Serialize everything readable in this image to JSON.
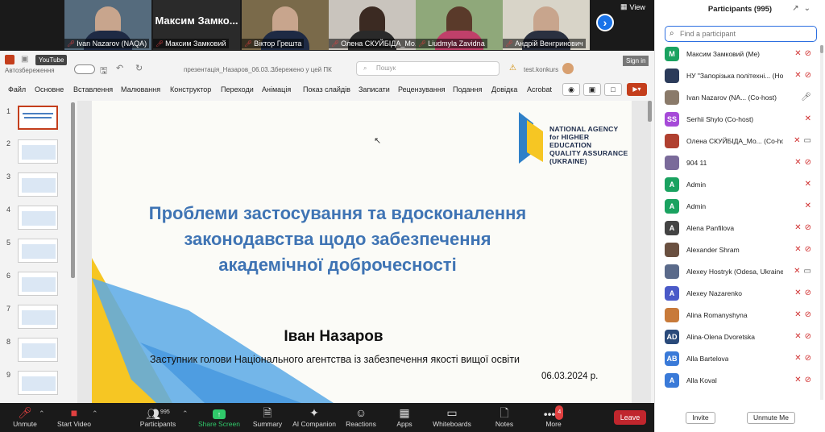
{
  "gallery": {
    "tiles": [
      {
        "name": "Ivan Nazarov (NAQA)"
      },
      {
        "name": "Максим Замковий",
        "big": "Максим Замко..."
      },
      {
        "name": "Віктор Грешта"
      },
      {
        "name": "Олена СКУЙБІДА_Мо..."
      },
      {
        "name": "Liudmyla Zavidna"
      },
      {
        "name": "Андрій Венгринович"
      }
    ],
    "view_label": "View"
  },
  "ppt": {
    "youtube": "YouTube",
    "autosave": "Автозбереження",
    "filename": "презентація_Назаров_06.03....",
    "saved": "Збережено у цей ПК",
    "search_placeholder": "Пошук",
    "account": "test.konkurs",
    "signin": "Sign in",
    "ribbon_tabs": [
      "Файл",
      "Основне",
      "Вставлення",
      "Малювання",
      "Конструктор",
      "Переходи",
      "Анімація",
      "Показ слайдів",
      "Записати",
      "Рецензування",
      "Подання",
      "Довідка",
      "Acrobat"
    ],
    "thumb_numbers": [
      "1",
      "2",
      "3",
      "4",
      "5",
      "6",
      "7",
      "8",
      "9"
    ],
    "slide": {
      "agency": [
        "NATIONAL AGENCY",
        "for HIGHER EDUCATION",
        "QUALITY ASSURANCE",
        "(UKRAINE)"
      ],
      "title": [
        "Проблеми застосування та вдосконалення",
        "законодавства щодо забезпечення",
        "академічної доброчесності"
      ],
      "author": "Іван Назаров",
      "position": "Заступник голови Національного агентства із забезпечення якості вищої освіти",
      "date": "06.03.2024 р."
    }
  },
  "toolbar": {
    "unmute": "Unmute",
    "start_video": "Start Video",
    "participants": "Participants",
    "participants_count": "995",
    "share": "Share Screen",
    "summary": "Summary",
    "ai": "AI Companion",
    "reactions": "Reactions",
    "apps": "Apps",
    "whiteboards": "Whiteboards",
    "notes": "Notes",
    "more": "More",
    "more_badge": "4",
    "leave": "Leave"
  },
  "panel": {
    "title": "Participants (995)",
    "find_placeholder": "Find a participant",
    "invite": "Invite",
    "mute_me": "Unmute Me",
    "participants": [
      {
        "initial": "M",
        "color": "#1aa260",
        "name": "Максим Замковий (Me)",
        "video": "off"
      },
      {
        "initial": "",
        "color": "#2b3b5a",
        "name": "НУ \"Запорізька політехні... (Host)",
        "video": "off"
      },
      {
        "initial": "",
        "color": "#8a7a6a",
        "name": "Ivan Nazarov (NA... (Co-host)",
        "video": "on"
      },
      {
        "initial": "SS",
        "color": "#a64ad8",
        "name": "Serhii Shylo (Co-host)",
        "video": "none"
      },
      {
        "initial": "",
        "color": "#b04030",
        "name": "Олена СКУЙБІДА_Мо... (Co-host)",
        "video": "cam"
      },
      {
        "initial": "",
        "color": "#7a6a9a",
        "name": "904 11",
        "video": "off"
      },
      {
        "initial": "A",
        "color": "#1aa260",
        "name": "Admin",
        "video": "none"
      },
      {
        "initial": "A",
        "color": "#1aa260",
        "name": "Admin",
        "video": "none"
      },
      {
        "initial": "A",
        "color": "#444444",
        "name": "Alena Panfilova",
        "video": "off"
      },
      {
        "initial": "",
        "color": "#6a5040",
        "name": "Alexander Shram",
        "video": "off"
      },
      {
        "initial": "",
        "color": "#5a6a8a",
        "name": "Alexey Hostryk (Odesa, Ukraine)",
        "video": "cam"
      },
      {
        "initial": "A",
        "color": "#4a5ac8",
        "name": "Alexey Nazarenko",
        "video": "off"
      },
      {
        "initial": "",
        "color": "#c87a3a",
        "name": "Alina Romanyshyna",
        "video": "off"
      },
      {
        "initial": "AD",
        "color": "#2a4a7a",
        "name": "Alina-Olena Dvoretska",
        "video": "off"
      },
      {
        "initial": "AB",
        "color": "#3a7ad8",
        "name": "Alla Bartelova",
        "video": "off"
      },
      {
        "initial": "A",
        "color": "#3a7ad8",
        "name": "Alla Koval",
        "video": "off"
      }
    ]
  }
}
